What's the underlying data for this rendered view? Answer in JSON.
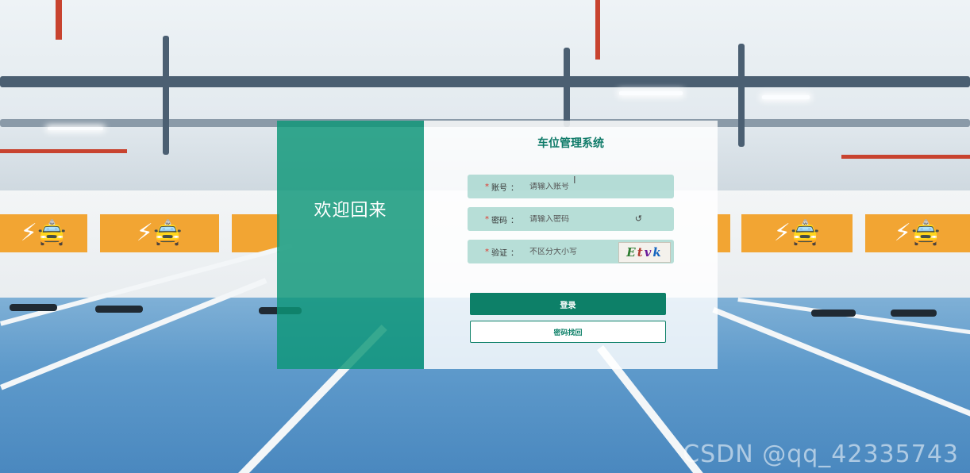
{
  "welcome": {
    "text": "欢迎回来"
  },
  "system": {
    "title": "车位管理系统"
  },
  "form": {
    "account": {
      "required_mark": "*",
      "label": "账号",
      "colon": "：",
      "placeholder": "请输入账号"
    },
    "password": {
      "required_mark": "*",
      "label": "密码",
      "colon": "：",
      "placeholder": "请输入密码"
    },
    "captcha": {
      "required_mark": "*",
      "label": "验证",
      "colon": "：",
      "placeholder": "不区分大小写",
      "code": [
        "E",
        "t",
        "v",
        "k"
      ]
    }
  },
  "buttons": {
    "login": "登录",
    "forgot": "密码找回"
  },
  "watermark": "CSDN @qq_42335743",
  "icons": {
    "password_toggle": "refresh-eye-icon",
    "cursor": "text-cursor-icon"
  },
  "colors": {
    "primary": "#0d8068",
    "welcome_bg": "#0c9678",
    "title": "#0e7a68",
    "required": "#e0352b"
  }
}
